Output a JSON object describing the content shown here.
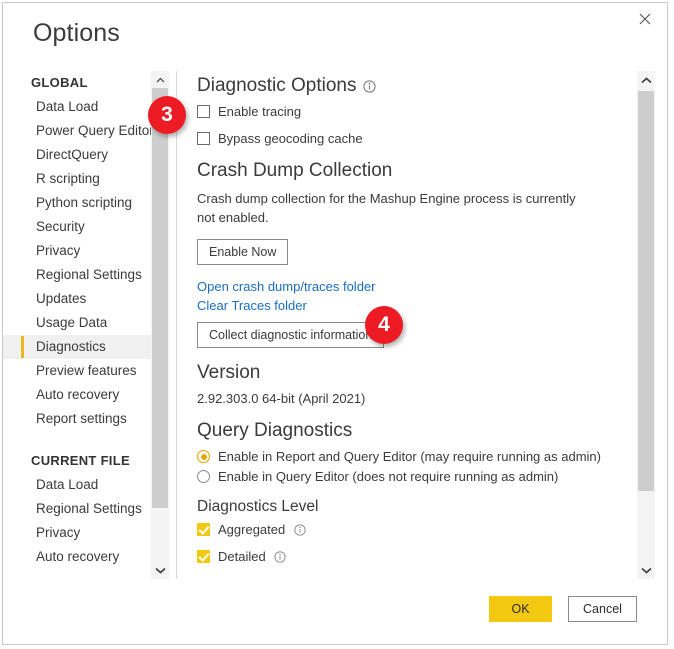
{
  "window": {
    "title": "Options",
    "close_icon": "close-icon"
  },
  "sidebar": {
    "groups": [
      {
        "title": "GLOBAL",
        "items": [
          {
            "label": "Data Load",
            "selected": false
          },
          {
            "label": "Power Query Editor",
            "selected": false
          },
          {
            "label": "DirectQuery",
            "selected": false
          },
          {
            "label": "R scripting",
            "selected": false
          },
          {
            "label": "Python scripting",
            "selected": false
          },
          {
            "label": "Security",
            "selected": false
          },
          {
            "label": "Privacy",
            "selected": false
          },
          {
            "label": "Regional Settings",
            "selected": false
          },
          {
            "label": "Updates",
            "selected": false
          },
          {
            "label": "Usage Data",
            "selected": false
          },
          {
            "label": "Diagnostics",
            "selected": true
          },
          {
            "label": "Preview features",
            "selected": false
          },
          {
            "label": "Auto recovery",
            "selected": false
          },
          {
            "label": "Report settings",
            "selected": false
          }
        ]
      },
      {
        "title": "CURRENT FILE",
        "items": [
          {
            "label": "Data Load",
            "selected": false
          },
          {
            "label": "Regional Settings",
            "selected": false
          },
          {
            "label": "Privacy",
            "selected": false
          },
          {
            "label": "Auto recovery",
            "selected": false
          }
        ]
      }
    ]
  },
  "main": {
    "diagnostic_options": {
      "heading": "Diagnostic Options",
      "info_icon": "info-icon",
      "enable_tracing": {
        "label": "Enable tracing",
        "checked": false
      },
      "bypass_geocoding": {
        "label": "Bypass geocoding cache",
        "checked": false
      }
    },
    "crash_dump": {
      "heading": "Crash Dump Collection",
      "description": "Crash dump collection for the Mashup Engine process is currently not enabled.",
      "enable_now_label": "Enable Now",
      "open_folder_link": "Open crash dump/traces folder",
      "clear_traces_link": "Clear Traces folder",
      "collect_label": "Collect diagnostic information"
    },
    "version": {
      "heading": "Version",
      "value": "2.92.303.0 64-bit (April 2021)"
    },
    "query_diagnostics": {
      "heading": "Query Diagnostics",
      "options": [
        {
          "label": "Enable in Report and Query Editor (may require running as admin)",
          "selected": true
        },
        {
          "label": "Enable in Query Editor (does not require running as admin)",
          "selected": false
        }
      ]
    },
    "diagnostics_level": {
      "heading": "Diagnostics Level",
      "items": [
        {
          "label": "Aggregated",
          "checked": true,
          "info_icon": "info-icon"
        },
        {
          "label": "Detailed",
          "checked": true,
          "info_icon": "info-icon"
        }
      ]
    }
  },
  "footer": {
    "ok_label": "OK",
    "cancel_label": "Cancel"
  },
  "annotations": [
    {
      "number": "3"
    },
    {
      "number": "4"
    }
  ],
  "colors": {
    "accent_yellow": "#f2c811",
    "link_blue": "#1a6ec0",
    "badge_red": "#ed1c24",
    "selected_bar": "#e8b81c"
  }
}
